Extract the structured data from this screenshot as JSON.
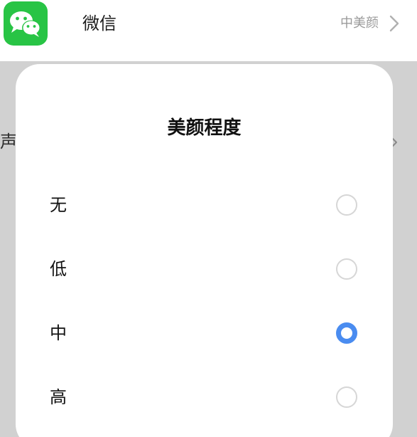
{
  "app_row": {
    "icon": "wechat-icon",
    "name": "微信",
    "value": "中美颜",
    "chevron": "chevron-right-icon"
  },
  "background_row": {
    "partial_label": "声"
  },
  "dialog": {
    "title": "美颜程度",
    "options": [
      {
        "label": "无",
        "selected": false
      },
      {
        "label": "低",
        "selected": false
      },
      {
        "label": "中",
        "selected": true
      },
      {
        "label": "高",
        "selected": false
      }
    ]
  },
  "colors": {
    "wechat_green": "#28c445",
    "accent_blue": "#4a8cf0",
    "radio_border": "#d6d6d6"
  }
}
